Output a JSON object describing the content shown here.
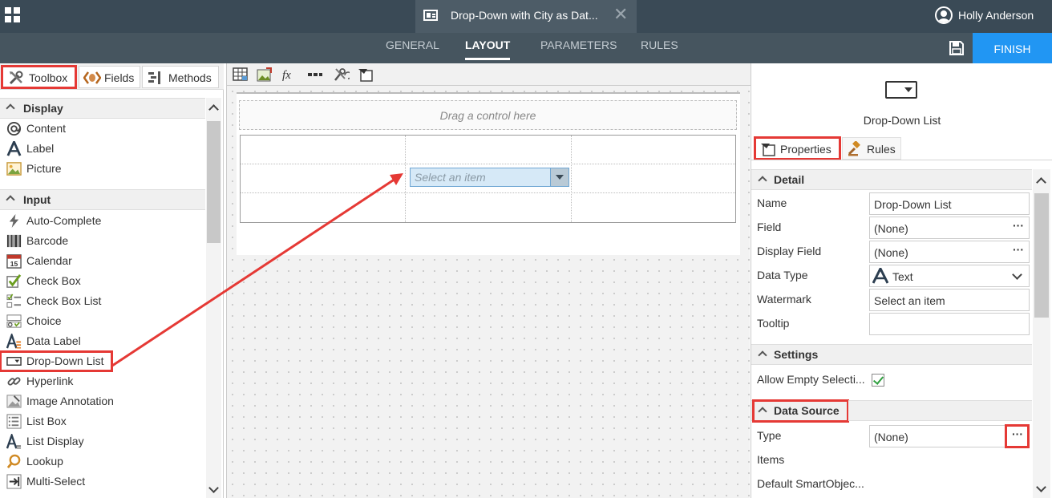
{
  "topbar": {
    "doc_title": "Drop-Down with City as Dat...",
    "close_glyph": "✕",
    "user_name": "Holly Anderson"
  },
  "nav": {
    "tabs": [
      "GENERAL",
      "LAYOUT",
      "PARAMETERS",
      "RULES"
    ],
    "active": "LAYOUT",
    "finish_label": "FINISH"
  },
  "left_panel": {
    "tabs": {
      "toolbox": "Toolbox",
      "fields": "Fields",
      "methods": "Methods"
    },
    "sections": [
      {
        "title": "Display",
        "items": [
          "Content",
          "Label",
          "Picture"
        ]
      },
      {
        "title": "Input",
        "items": [
          "Auto-Complete",
          "Barcode",
          "Calendar",
          "Check Box",
          "Check Box List",
          "Choice",
          "Data Label",
          "Drop-Down List",
          "Hyperlink",
          "Image Annotation",
          "List Box",
          "List Display",
          "Lookup",
          "Multi-Select"
        ]
      }
    ]
  },
  "canvas": {
    "drag_hint": "Drag a control here",
    "dropdown_placeholder": "Select an item"
  },
  "right_panel": {
    "control_name": "Drop-Down List",
    "tabs": {
      "properties": "Properties",
      "rules": "Rules"
    },
    "detail": {
      "title": "Detail",
      "rows": [
        {
          "key": "Name",
          "value": "Drop-Down List"
        },
        {
          "key": "Field",
          "value": "(None)"
        },
        {
          "key": "Display Field",
          "value": "(None)"
        },
        {
          "key": "Data Type",
          "value": "Text"
        },
        {
          "key": "Watermark",
          "value": "Select an item"
        },
        {
          "key": "Tooltip",
          "value": ""
        }
      ]
    },
    "settings": {
      "title": "Settings",
      "allow_empty_label": "Allow Empty Selecti...",
      "allow_empty_checked": true
    },
    "data_source": {
      "title": "Data Source",
      "type_label": "Type",
      "type_value": "(None)",
      "items_label": "Items",
      "default_label": "Default SmartObjec..."
    }
  },
  "colors": {
    "topbar": "#3a4a56",
    "navbar": "#46555f",
    "finish": "#2196f3",
    "highlight_red": "#e53935"
  }
}
